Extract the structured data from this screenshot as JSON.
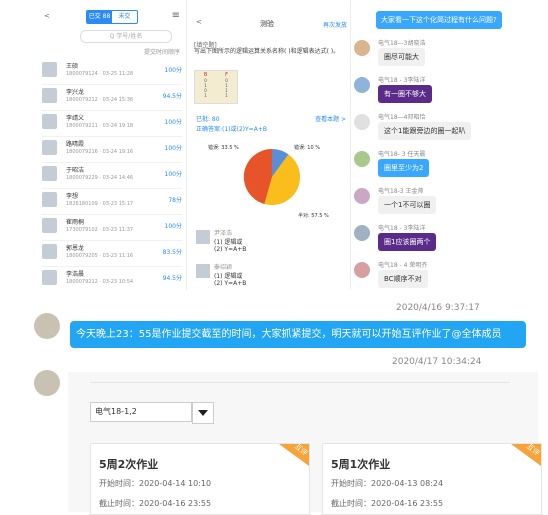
{
  "panel1": {
    "nav": {
      "back": "<",
      "menu": "≡",
      "tab_active": "已交 88",
      "tab_other": "未交"
    },
    "search_placeholder": "Q 学号/姓名",
    "sort_label": "提交时间顺序",
    "students": [
      {
        "name": "王硕",
        "sub": "1800079124 · 03-25 11:28",
        "score": "100分"
      },
      {
        "name": "李兴龙",
        "sub": "1800079212 · 03-24 15:36",
        "score": "94.5分"
      },
      {
        "name": "李靖义",
        "sub": "1800079211 · 03-24 19:18",
        "score": "100分"
      },
      {
        "name": "路晴霞",
        "sub": "1800079216 · 03-24 19:16",
        "score": "100分"
      },
      {
        "name": "于昭洁",
        "sub": "1800079229 · 03-24 14:46",
        "score": "100分"
      },
      {
        "name": "李想",
        "sub": "1826180109 · 03-23 15:17",
        "score": "78分"
      },
      {
        "name": "崔雨桐",
        "sub": "1730079102 · 03-23 11:37",
        "score": "100分"
      },
      {
        "name": "郭恩龙",
        "sub": "1800079205 · 03-23 11:16",
        "score": "83.5分"
      },
      {
        "name": "李浩晨",
        "sub": "1800079212 · 03-23 10:54",
        "score": "94.5分"
      }
    ]
  },
  "panel2": {
    "back": "<",
    "title": "测验",
    "action": "再次发放",
    "question_type": "[填空题]",
    "question_text": "写出下图所示的逻辑运算关系名称( )和逻辑表达式( )。",
    "truth_table": {
      "headers": [
        "B",
        "F"
      ],
      "rows": [
        [
          "0",
          "0"
        ],
        [
          "1",
          "1"
        ],
        [
          "0",
          "1"
        ],
        [
          "1",
          "1"
        ]
      ]
    },
    "score_label": "已批: 80",
    "view_label": "查看本题 >",
    "correct_answer": "正确答案:(1)或(2)Y=A+B",
    "pie_labels": {
      "blue": "错误: 10 %",
      "orange": "错误: 33.5 %",
      "yellow": "半对: 57.5 %"
    },
    "answers": [
      {
        "name": "尹泽浩",
        "a1": "(1) 逻辑或",
        "a2": "(2) Y=A+B"
      },
      {
        "name": "秦绍颖",
        "a1": "(1) 逻辑或",
        "a2": "(2) Y=A+B"
      }
    ]
  },
  "panel3": {
    "top_bubble": "大家看一下这个化简过程有什么问题?",
    "chat": [
      {
        "name": "电气18—3胡晓浩",
        "text": "圈尽可能大",
        "style": "white"
      },
      {
        "name": "电气18 - 3李陆洋",
        "text": "有一圈不够大",
        "style": "purple"
      },
      {
        "name": "电气18—4邓昭恰",
        "text": "这个1能跟旁边的圈一起叭",
        "style": "white"
      },
      {
        "name": "电气18- 3 任天晨",
        "text": "圈里至少为2",
        "style": "blue"
      },
      {
        "name": "电气18-3 王金帅",
        "text": "一个1不可以圈",
        "style": "white"
      },
      {
        "name": "电气18 - 3李陆洋",
        "text": "圈1应该圈两个",
        "style": "purple"
      },
      {
        "name": "电气18 - 4 荣明齐",
        "text": "BC顺序不对",
        "style": "white"
      }
    ]
  },
  "timestamps": {
    "first": "2020/4/16 9:37:17",
    "second": "2020/4/17 10:34:24"
  },
  "announcement": "今天晚上23：55是作业提交截至的时间，大家抓紧提交，明天就可以开始互评作业了@全体成员",
  "homework": {
    "class_select": "电气18-1,2",
    "cards": [
      {
        "title": "5周2次作业",
        "start": "开始时间：2020-04-14 10:10",
        "end": "截止时间：2020-04-16 23:55",
        "tag": "互评"
      },
      {
        "title": "5周1次作业",
        "start": "开始时间：2020-04-13 08:24",
        "end": "截止时间：2020-04-16 23:55",
        "tag": "互评"
      }
    ]
  },
  "colors": {
    "accent": "#2a8cf0",
    "announce_bg": "#22a5f3",
    "purple_bubble": "#5b2b8a",
    "ribbon": "#f6a33a"
  }
}
